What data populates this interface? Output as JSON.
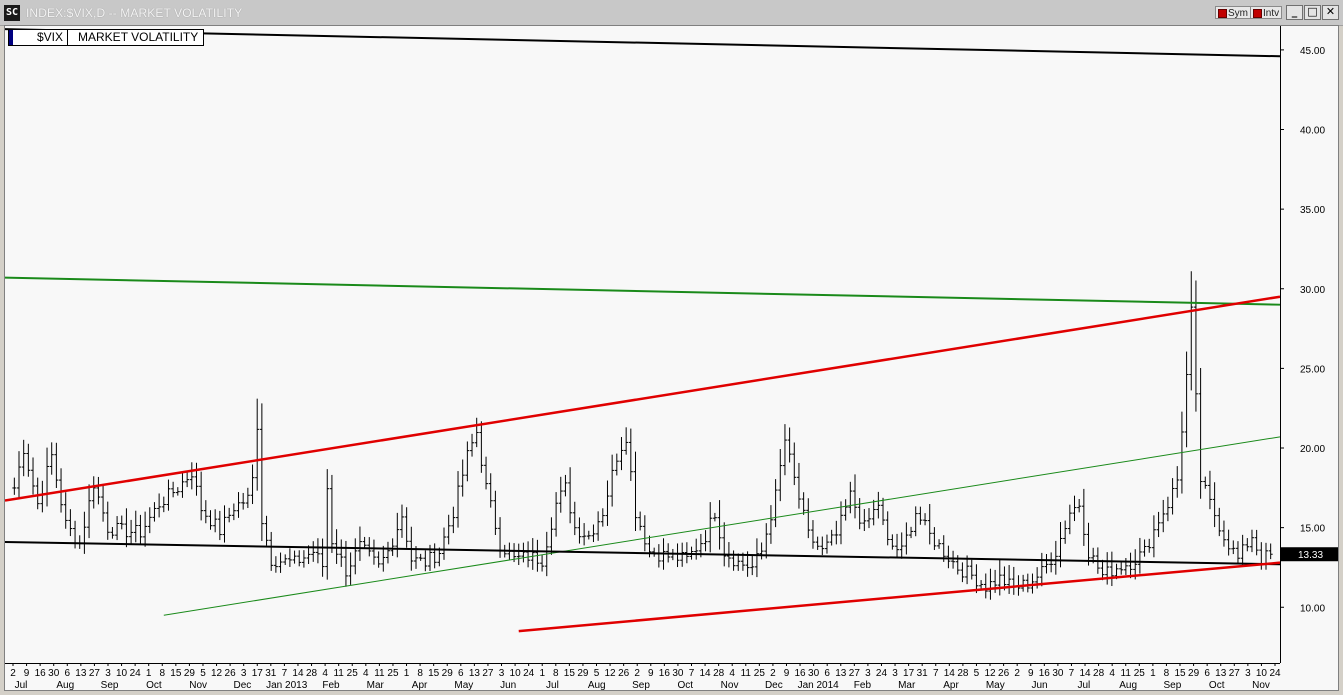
{
  "window": {
    "title": "INDEX:$VIX,D -- MARKET VOLATILITY",
    "app_icon_text": "SC",
    "sym_toggle": "Sym",
    "intv_toggle": "Intv",
    "minimize": "_",
    "maximize": "□",
    "close": "✕"
  },
  "legend": {
    "symbol": "$VIX",
    "name": "MARKET VOLATILITY"
  },
  "colors": {
    "trend_red": "#e00000",
    "trend_green": "#1a8a1a",
    "trend_black": "#000000",
    "bars": "#000000",
    "background": "#f8f8f8"
  },
  "chart_data": {
    "type": "ohlc",
    "symbol": "$VIX",
    "title": "INDEX:$VIX,D -- MARKET VOLATILITY",
    "ylim": [
      6.5,
      46.5
    ],
    "ytick_values": [
      10,
      15,
      20,
      25,
      30,
      35,
      40,
      45
    ],
    "ytick_labels": [
      "10.00",
      "15.00",
      "20.00",
      "25.00",
      "30.00",
      "35.00",
      "40.00",
      "45.00"
    ],
    "last_value": 13.33,
    "last_value_label": "13.33",
    "grid": false,
    "date_labels": [
      "2",
      "9",
      "16",
      "30",
      "6",
      "13",
      "27",
      "3",
      "10",
      "24",
      "1",
      "8",
      "15",
      "29",
      "5",
      "12",
      "26",
      "3",
      "17",
      "31",
      "7",
      "14",
      "28",
      "4",
      "11",
      "25",
      "4",
      "11",
      "25",
      "1",
      "8",
      "15",
      "29",
      "6",
      "13",
      "27",
      "3",
      "10",
      "24",
      "1",
      "8",
      "15",
      "29",
      "5",
      "12",
      "26",
      "2",
      "9",
      "16",
      "30",
      "7",
      "14",
      "28",
      "4",
      "11",
      "25",
      "2",
      "9",
      "16",
      "30",
      "6",
      "13",
      "27",
      "3",
      "24",
      "3",
      "17",
      "31",
      "7",
      "14",
      "28",
      "5",
      "12",
      "26",
      "2",
      "9",
      "16",
      "30",
      "7",
      "14",
      "28",
      "4",
      "11",
      "25",
      "1",
      "8",
      "15",
      "29",
      "6",
      "13",
      "27",
      "3",
      "10",
      "24"
    ],
    "month_labels": [
      "Jul",
      "Aug",
      "Sep",
      "Oct",
      "Nov",
      "Dec",
      "Jan 2013",
      "Feb",
      "Mar",
      "Apr",
      "May",
      "Jun",
      "Jul",
      "Aug",
      "Sep",
      "Oct",
      "Nov",
      "Dec",
      "Jan 2014",
      "Feb",
      "Mar",
      "Apr",
      "May",
      "Jun",
      "Jul",
      "Aug",
      "Sep",
      "Oct",
      "Nov"
    ],
    "key_points": [
      {
        "x": 0,
        "y": 17.5
      },
      {
        "x": 2,
        "y": 20
      },
      {
        "x": 5,
        "y": 16.5
      },
      {
        "x": 8,
        "y": 19.5
      },
      {
        "x": 11,
        "y": 15.2
      },
      {
        "x": 14,
        "y": 14
      },
      {
        "x": 17,
        "y": 17.8
      },
      {
        "x": 20,
        "y": 15.0
      },
      {
        "x": 23,
        "y": 14.8
      },
      {
        "x": 27,
        "y": 14.7
      },
      {
        "x": 31,
        "y": 16.5
      },
      {
        "x": 35,
        "y": 17.5
      },
      {
        "x": 38,
        "y": 18.5
      },
      {
        "x": 40,
        "y": 16.2
      },
      {
        "x": 42,
        "y": 15.5
      },
      {
        "x": 44,
        "y": 14.8
      },
      {
        "x": 47,
        "y": 16.3
      },
      {
        "x": 50,
        "y": 16.8
      },
      {
        "x": 51,
        "y": 18
      },
      {
        "x": 52,
        "y": 21.5
      },
      {
        "x": 53,
        "y": 15.5
      },
      {
        "x": 55,
        "y": 13.0
      },
      {
        "x": 60,
        "y": 12.8
      },
      {
        "x": 64,
        "y": 13.5
      },
      {
        "x": 66,
        "y": 12.6
      },
      {
        "x": 67,
        "y": 17.5
      },
      {
        "x": 68,
        "y": 14.2
      },
      {
        "x": 71,
        "y": 12.3
      },
      {
        "x": 74,
        "y": 13.8
      },
      {
        "x": 78,
        "y": 12.5
      },
      {
        "x": 80,
        "y": 13.5
      },
      {
        "x": 83,
        "y": 15.8
      },
      {
        "x": 85,
        "y": 13.0
      },
      {
        "x": 88,
        "y": 12.8
      },
      {
        "x": 91,
        "y": 13.5
      },
      {
        "x": 94,
        "y": 16.0
      },
      {
        "x": 97,
        "y": 19.5
      },
      {
        "x": 99,
        "y": 21.0
      },
      {
        "x": 101,
        "y": 17.5
      },
      {
        "x": 104,
        "y": 14.0
      },
      {
        "x": 107,
        "y": 13.0
      },
      {
        "x": 110,
        "y": 13.2
      },
      {
        "x": 113,
        "y": 13.0
      },
      {
        "x": 116,
        "y": 16.5
      },
      {
        "x": 118,
        "y": 17.5
      },
      {
        "x": 120,
        "y": 15.0
      },
      {
        "x": 123,
        "y": 14.5
      },
      {
        "x": 126,
        "y": 16.0
      },
      {
        "x": 129,
        "y": 19.5
      },
      {
        "x": 131,
        "y": 20.8
      },
      {
        "x": 133,
        "y": 16.0
      },
      {
        "x": 136,
        "y": 13.5
      },
      {
        "x": 140,
        "y": 13.2
      },
      {
        "x": 144,
        "y": 13.0
      },
      {
        "x": 148,
        "y": 14.5
      },
      {
        "x": 150,
        "y": 16.0
      },
      {
        "x": 152,
        "y": 13.5
      },
      {
        "x": 155,
        "y": 12.8
      },
      {
        "x": 158,
        "y": 12.5
      },
      {
        "x": 160,
        "y": 13.5
      },
      {
        "x": 163,
        "y": 17.0
      },
      {
        "x": 165,
        "y": 20.5
      },
      {
        "x": 167,
        "y": 18.0
      },
      {
        "x": 170,
        "y": 14.5
      },
      {
        "x": 173,
        "y": 13.5
      },
      {
        "x": 176,
        "y": 14.5
      },
      {
        "x": 179,
        "y": 17.0
      },
      {
        "x": 182,
        "y": 15.0
      },
      {
        "x": 185,
        "y": 16.5
      },
      {
        "x": 187,
        "y": 14.0
      },
      {
        "x": 190,
        "y": 13.5
      },
      {
        "x": 193,
        "y": 16.0
      },
      {
        "x": 196,
        "y": 14.5
      },
      {
        "x": 199,
        "y": 13.5
      },
      {
        "x": 202,
        "y": 12.5
      },
      {
        "x": 205,
        "y": 12.0
      },
      {
        "x": 208,
        "y": 11.3
      },
      {
        "x": 211,
        "y": 11.8
      },
      {
        "x": 214,
        "y": 11.2
      },
      {
        "x": 217,
        "y": 11.5
      },
      {
        "x": 220,
        "y": 12.2
      },
      {
        "x": 223,
        "y": 13.5
      },
      {
        "x": 226,
        "y": 16.0
      },
      {
        "x": 228,
        "y": 16.5
      },
      {
        "x": 230,
        "y": 13.5
      },
      {
        "x": 233,
        "y": 12.0
      },
      {
        "x": 236,
        "y": 12.5
      },
      {
        "x": 239,
        "y": 12.8
      },
      {
        "x": 242,
        "y": 13.5
      },
      {
        "x": 245,
        "y": 15.5
      },
      {
        "x": 247,
        "y": 16.5
      },
      {
        "x": 249,
        "y": 18.0
      },
      {
        "x": 251,
        "y": 24.5
      },
      {
        "x": 252,
        "y": 28.5
      },
      {
        "x": 253,
        "y": 23.0
      },
      {
        "x": 254,
        "y": 18.0
      },
      {
        "x": 256,
        "y": 16.5
      },
      {
        "x": 259,
        "y": 14.5
      },
      {
        "x": 262,
        "y": 13.0
      },
      {
        "x": 265,
        "y": 14.5
      },
      {
        "x": 267,
        "y": 13.0
      },
      {
        "x": 269,
        "y": 13.33
      }
    ],
    "spikes": [
      {
        "x": 52,
        "y": 23.1
      },
      {
        "x": 99,
        "y": 21.9
      },
      {
        "x": 131,
        "y": 21.3
      },
      {
        "x": 165,
        "y": 21.5
      },
      {
        "x": 252,
        "y": 31.1
      }
    ],
    "trendlines": [
      {
        "color": "black",
        "from": {
          "x": -2,
          "y": 46.3
        },
        "to": {
          "x": 271,
          "y": 44.6
        }
      },
      {
        "color": "green",
        "from": {
          "x": -2,
          "y": 30.7
        },
        "to": {
          "x": 271,
          "y": 29.0
        }
      },
      {
        "color": "red",
        "from": {
          "x": -2,
          "y": 16.7
        },
        "to": {
          "x": 271,
          "y": 29.5
        }
      },
      {
        "color": "green",
        "from": {
          "x": 32,
          "y": 9.5
        },
        "to": {
          "x": 271,
          "y": 20.7
        }
      },
      {
        "color": "black",
        "from": {
          "x": -2,
          "y": 14.1
        },
        "to": {
          "x": 271,
          "y": 12.7
        }
      },
      {
        "color": "red",
        "from": {
          "x": 108,
          "y": 8.5
        },
        "to": {
          "x": 271,
          "y": 12.8
        }
      }
    ],
    "x_range": [
      -2,
      271
    ]
  }
}
